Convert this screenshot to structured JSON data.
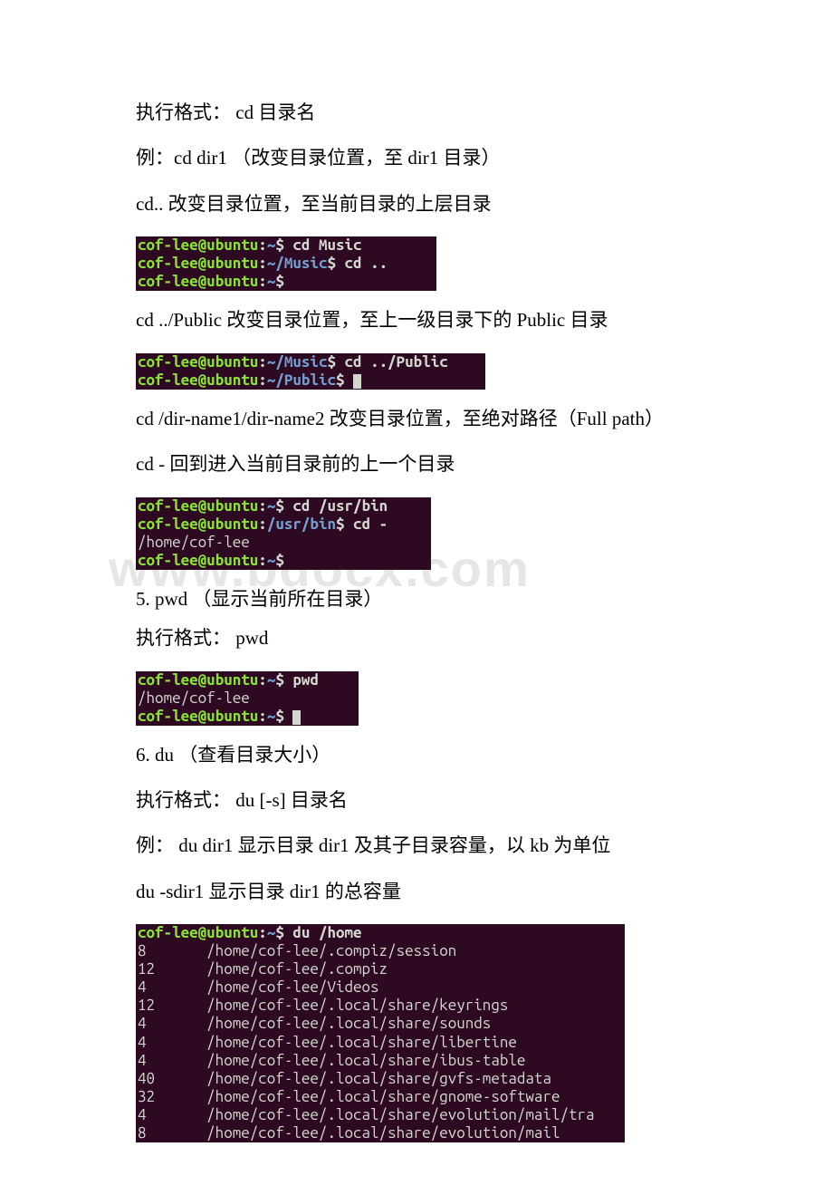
{
  "text": {
    "l1": "执行格式： cd 目录名",
    "l2": "例：cd dir1 （改变目录位置，至 dir1 目录）",
    "l3": "cd.. 改变目录位置，至当前目录的上层目录",
    "l4": "cd ../Public 改变目录位置，至上一级目录下的 Public 目录",
    "l5": "cd /dir-name1/dir-name2 改变目录位置，至绝对路径（Full path）",
    "l6": "cd - 回到进入当前目录前的上一个目录",
    "l7": "5. pwd （显示当前所在目录）",
    "l8": "执行格式： pwd",
    "l9": "6. du （查看目录大小）",
    "l10": "执行格式： du [-s] 目录名",
    "l11": "例： du dir1 显示目录 dir1 及其子目录容量，以 kb 为单位",
    "l12": "du -sdir1 显示目录 dir1 的总容量"
  },
  "watermark": "www.bdocx.com",
  "term": {
    "user": "cof-lee",
    "host": "ubuntu",
    "t1": {
      "p1": "~",
      "c1": "cd Music",
      "p2": "~/Music",
      "c2": "cd ..",
      "p3": "~",
      "c3": ""
    },
    "t2": {
      "p1": "~/Music",
      "c1": "cd ../Public",
      "p2": "~/Public",
      "c2": ""
    },
    "t3": {
      "p1": "~",
      "c1": "cd /usr/bin",
      "p2": "/usr/bin",
      "c2": "cd -",
      "out1": "/home/cof-lee",
      "p3": "~",
      "c3": ""
    },
    "t4": {
      "p1": "~",
      "c1": "pwd",
      "out1": "/home/cof-lee",
      "p2": "~",
      "c2": ""
    },
    "t5": {
      "p1": "~",
      "c1": "du /home",
      "rows": [
        {
          "sz": "8",
          "path": "/home/cof-lee/.compiz/session"
        },
        {
          "sz": "12",
          "path": "/home/cof-lee/.compiz"
        },
        {
          "sz": "4",
          "path": "/home/cof-lee/Videos"
        },
        {
          "sz": "12",
          "path": "/home/cof-lee/.local/share/keyrings"
        },
        {
          "sz": "4",
          "path": "/home/cof-lee/.local/share/sounds"
        },
        {
          "sz": "4",
          "path": "/home/cof-lee/.local/share/libertine"
        },
        {
          "sz": "4",
          "path": "/home/cof-lee/.local/share/ibus-table"
        },
        {
          "sz": "40",
          "path": "/home/cof-lee/.local/share/gvfs-metadata"
        },
        {
          "sz": "32",
          "path": "/home/cof-lee/.local/share/gnome-software"
        },
        {
          "sz": "4",
          "path": "/home/cof-lee/.local/share/evolution/mail/tra"
        },
        {
          "sz": "8",
          "path": "/home/cof-lee/.local/share/evolution/mail"
        }
      ]
    }
  }
}
